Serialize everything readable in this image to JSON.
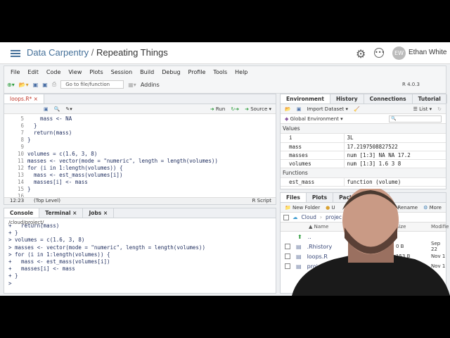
{
  "header": {
    "workspace": "Data Carpentry",
    "separator": "/",
    "project": "Repeating Things",
    "user_initials": "EW",
    "user_name": "Ethan White",
    "gear_icon": "gear-icon",
    "more_icon": "ellipsis-icon"
  },
  "menu": [
    "File",
    "Edit",
    "Code",
    "View",
    "Plots",
    "Session",
    "Build",
    "Debug",
    "Profile",
    "Tools",
    "Help"
  ],
  "toolbar": {
    "goto_placeholder": "Go to file/function",
    "addins": "Addins",
    "r_version": "R 4.0.3"
  },
  "editor": {
    "tab": "loops.R*",
    "run": "Run",
    "source": "Source",
    "cursor_pos": "12:23",
    "scope": "(Top Level)",
    "file_type": "R Script",
    "lines": [
      {
        "n": "5",
        "t": "    mass <- NA"
      },
      {
        "n": "6",
        "t": "  }"
      },
      {
        "n": "7",
        "t": "  return(mass)"
      },
      {
        "n": "8",
        "t": "}"
      },
      {
        "n": "9",
        "t": ""
      },
      {
        "n": "10",
        "t": "volumes = c(1.6, 3, 8)"
      },
      {
        "n": "11",
        "t": "masses <- vector(mode = \"numeric\", length = length(volumes))"
      },
      {
        "n": "12",
        "t": "for (i in 1:length(volumes)) {"
      },
      {
        "n": "13",
        "t": "  mass <- est_mass(volumes[i])"
      },
      {
        "n": "14",
        "t": "  masses[i] <- mass"
      },
      {
        "n": "15",
        "t": "}"
      },
      {
        "n": "16",
        "t": ""
      }
    ]
  },
  "console": {
    "tabs": [
      "Console",
      "Terminal",
      "Jobs"
    ],
    "path": "/cloud/project/",
    "lines": [
      "+   return(mass)",
      "+ }",
      "> volumes = c(1.6, 3, 8)",
      "> masses <- vector(mode = \"numeric\", length = length(volumes))",
      "> for (i in 1:length(volumes)) {",
      "+   mass <- est_mass(volumes[i])",
      "+   masses[i] <- mass",
      "+ }",
      "> "
    ]
  },
  "environment": {
    "tabs": [
      "Environment",
      "History",
      "Connections",
      "Tutorial"
    ],
    "import": "Import Dataset",
    "view": "List",
    "scope": "Global Environment",
    "values_header": "Values",
    "values": [
      {
        "name": "i",
        "value": "3L"
      },
      {
        "name": "mass",
        "value": "17.2197508827522"
      },
      {
        "name": "masses",
        "value": "num [1:3] NA NA 17.2"
      },
      {
        "name": "volumes",
        "value": "num [1:3] 1.6 3 8"
      }
    ],
    "functions_header": "Functions",
    "functions": [
      {
        "name": "est_mass",
        "value": "function (volume)"
      }
    ]
  },
  "files": {
    "tabs": [
      "Files",
      "Plots",
      "Packag",
      "wer"
    ],
    "new_folder": "New Folder",
    "upload": "U",
    "rename": "Rename",
    "more": "More",
    "crumb_root": "Cloud",
    "crumb_dir": "projec",
    "col_name": "Name",
    "col_size": "Size",
    "col_modified": "Modifie",
    "up": "..",
    "rows": [
      {
        "name": ".Rhistory",
        "size": "0 B",
        "modified": "Sep 22"
      },
      {
        "name": "loops.R",
        "size": "153 B",
        "modified": "Nov 1"
      },
      {
        "name": "proj",
        "size": "",
        "modified": "Nov 1"
      }
    ]
  }
}
